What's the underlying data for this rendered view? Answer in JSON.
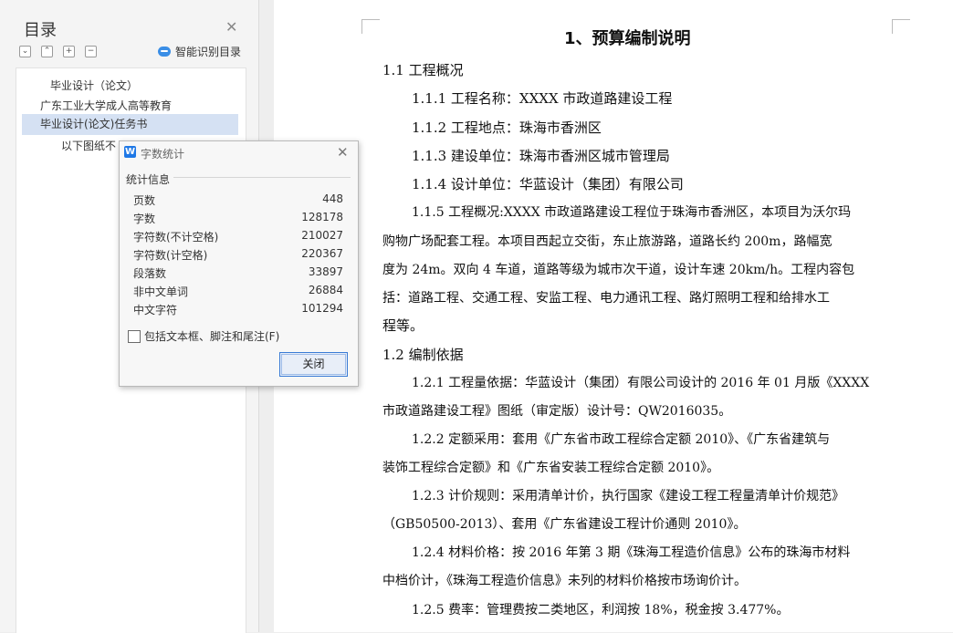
{
  "sidebar": {
    "title": "目录",
    "close_icon": "close-icon",
    "toolbar_icons": [
      "collapse-all-icon",
      "expand-all-icon",
      "add-heading-icon",
      "remove-heading-icon"
    ],
    "ai_label": "智能识别目录",
    "toc_items": [
      "毕业设计（论文）",
      "广东工业大学成人高等教育",
      "毕业设计(论文)任务书",
      "以下图纸不"
    ]
  },
  "dialog": {
    "title": "字数统计",
    "section": "统计信息",
    "stats": [
      {
        "label": "页数",
        "value": "448"
      },
      {
        "label": "字数",
        "value": "128178"
      },
      {
        "label": "字符数(不计空格)",
        "value": "210027"
      },
      {
        "label": "字符数(计空格)",
        "value": "220367"
      },
      {
        "label": "段落数",
        "value": "33897"
      },
      {
        "label": "非中文单词",
        "value": "26884"
      },
      {
        "label": "中文字符",
        "value": "101294"
      }
    ],
    "checkbox_label": "包括文本框、脚注和尾注(F)",
    "close_button": "关闭"
  },
  "document": {
    "heading": "1、预算编制说明",
    "lines": [
      "1.1 工程概况",
      "1.1.1 工程名称：XXXX 市政道路建设工程",
      "1.1.2 工程地点：珠海市香洲区",
      "1.1.3 建设单位：珠海市香洲区城市管理局",
      "1.1.4 设计单位：华蓝设计（集团）有限公司",
      "1.1.5 工程概况:XXXX 市政道路建设工程位于珠海市香洲区，本项目为沃尔玛",
      "购物广场配套工程。本项目西起立交街，东止旅游路，道路长约 200m，路幅宽",
      "度为 24m。双向 4 车道，道路等级为城市次干道，设计车速 20km/h。工程内容包",
      "括：道路工程、交通工程、安监工程、电力通讯工程、路灯照明工程和给排水工",
      "程等。",
      "1.2 编制依据",
      "1.2.1 工程量依据：华蓝设计（集团）有限公司设计的 2016 年 01 月版《XXXX",
      "市政道路建设工程》图纸（审定版）设计号：QW2016035。",
      "1.2.2 定额采用：套用《广东省市政工程综合定额 2010》、《广东省建筑与",
      "装饰工程综合定额》和《广东省安装工程综合定额 2010》。",
      "1.2.3 计价规则：采用清单计价，执行国家《建设工程工程量清单计价规范》",
      "（GB50500-2013）、套用《广东省建设工程计价通则 2010》。",
      "1.2.4 材料价格：按 2016 年第 3 期《珠海工程造价信息》公布的珠海市材料",
      "中档价计，《珠海工程造价信息》未列的材料价格按市场询价计。",
      "1.2.5 费率：管理费按二类地区，利润按 18%，税金按 3.477%。"
    ]
  }
}
